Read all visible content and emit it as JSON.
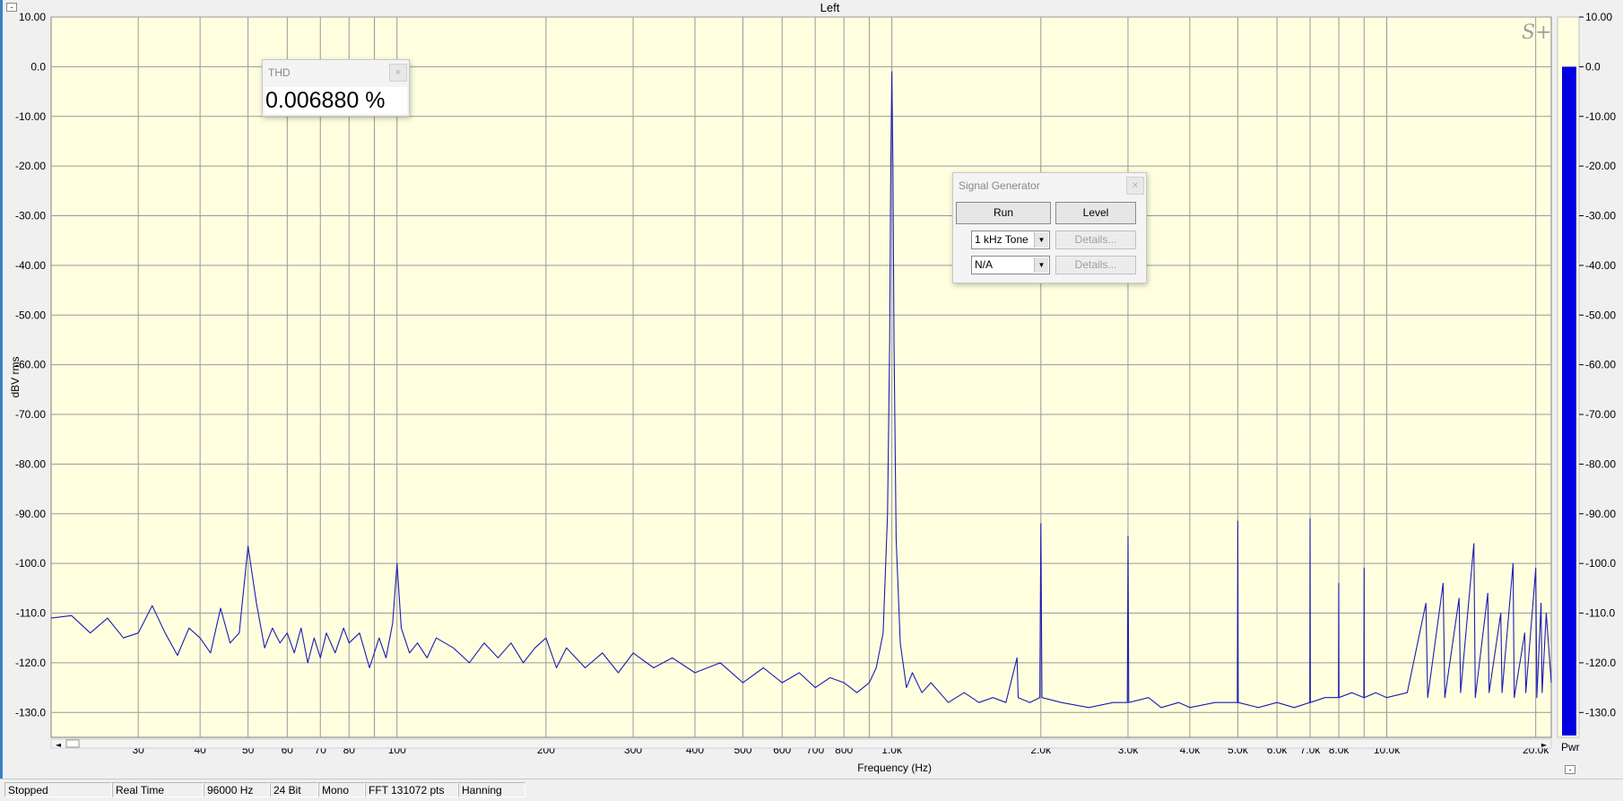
{
  "chart_data": {
    "type": "line",
    "title": "Left",
    "xlabel": "Frequency (Hz)",
    "ylabel": "dBV rms",
    "xscale": "log",
    "xlim": [
      20,
      21500
    ],
    "ylim": [
      -135,
      10
    ],
    "grid": true,
    "x_ticks": [
      {
        "v": 30,
        "label": "30"
      },
      {
        "v": 40,
        "label": "40"
      },
      {
        "v": 50,
        "label": "50"
      },
      {
        "v": 60,
        "label": "60"
      },
      {
        "v": 70,
        "label": "70"
      },
      {
        "v": 80,
        "label": "80"
      },
      {
        "v": 90,
        "label": ""
      },
      {
        "v": 100,
        "label": "100"
      },
      {
        "v": 200,
        "label": "200"
      },
      {
        "v": 300,
        "label": "300"
      },
      {
        "v": 400,
        "label": "400"
      },
      {
        "v": 500,
        "label": "500"
      },
      {
        "v": 600,
        "label": "600"
      },
      {
        "v": 700,
        "label": "700"
      },
      {
        "v": 800,
        "label": "800"
      },
      {
        "v": 900,
        "label": ""
      },
      {
        "v": 1000,
        "label": "1.0k"
      },
      {
        "v": 2000,
        "label": "2.0k"
      },
      {
        "v": 3000,
        "label": "3.0k"
      },
      {
        "v": 4000,
        "label": "4.0k"
      },
      {
        "v": 5000,
        "label": "5.0k"
      },
      {
        "v": 6000,
        "label": "6.0k"
      },
      {
        "v": 7000,
        "label": "7.0k"
      },
      {
        "v": 8000,
        "label": "8.0k"
      },
      {
        "v": 9000,
        "label": ""
      },
      {
        "v": 10000,
        "label": "10.0k"
      },
      {
        "v": 20000,
        "label": "20.0k"
      }
    ],
    "y_ticks": [
      {
        "v": 10,
        "label": "10.00"
      },
      {
        "v": 0,
        "label": "0.0"
      },
      {
        "v": -10,
        "label": "-10.00"
      },
      {
        "v": -20,
        "label": "-20.00"
      },
      {
        "v": -30,
        "label": "-30.00"
      },
      {
        "v": -40,
        "label": "-40.00"
      },
      {
        "v": -50,
        "label": "-50.00"
      },
      {
        "v": -60,
        "label": "-60.00"
      },
      {
        "v": -70,
        "label": "-70.00"
      },
      {
        "v": -80,
        "label": "-80.00"
      },
      {
        "v": -90,
        "label": "-90.00"
      },
      {
        "v": -100,
        "label": "-100.0"
      },
      {
        "v": -110,
        "label": "-110.0"
      },
      {
        "v": -120,
        "label": "-120.0"
      },
      {
        "v": -130,
        "label": "-130.0"
      }
    ],
    "series": [
      {
        "color": "#1c1cb4",
        "points": [
          [
            20,
            -111
          ],
          [
            22,
            -110.5
          ],
          [
            24,
            -114
          ],
          [
            26,
            -111
          ],
          [
            28,
            -115
          ],
          [
            30,
            -114
          ],
          [
            32,
            -108.5
          ],
          [
            34,
            -114
          ],
          [
            36,
            -118.5
          ],
          [
            38,
            -113
          ],
          [
            40,
            -115
          ],
          [
            42,
            -118
          ],
          [
            44,
            -109
          ],
          [
            46,
            -116
          ],
          [
            48,
            -114
          ],
          [
            50,
            -96.5
          ],
          [
            52,
            -108
          ],
          [
            54,
            -117
          ],
          [
            56,
            -113
          ],
          [
            58,
            -116
          ],
          [
            60,
            -114
          ],
          [
            62,
            -118
          ],
          [
            64,
            -113
          ],
          [
            66,
            -120
          ],
          [
            68,
            -115
          ],
          [
            70,
            -119
          ],
          [
            72,
            -114
          ],
          [
            75,
            -118
          ],
          [
            78,
            -113
          ],
          [
            80,
            -116
          ],
          [
            84,
            -114
          ],
          [
            88,
            -121
          ],
          [
            92,
            -115
          ],
          [
            95,
            -119
          ],
          [
            98,
            -112
          ],
          [
            100,
            -100
          ],
          [
            102,
            -113
          ],
          [
            106,
            -118
          ],
          [
            110,
            -116
          ],
          [
            115,
            -119
          ],
          [
            120,
            -115
          ],
          [
            130,
            -117
          ],
          [
            140,
            -120
          ],
          [
            150,
            -116
          ],
          [
            160,
            -119
          ],
          [
            170,
            -116
          ],
          [
            180,
            -120
          ],
          [
            190,
            -117
          ],
          [
            200,
            -115
          ],
          [
            210,
            -121
          ],
          [
            220,
            -117
          ],
          [
            240,
            -121
          ],
          [
            260,
            -118
          ],
          [
            280,
            -122
          ],
          [
            300,
            -118
          ],
          [
            330,
            -121
          ],
          [
            360,
            -119
          ],
          [
            400,
            -122
          ],
          [
            450,
            -120
          ],
          [
            500,
            -124
          ],
          [
            550,
            -121
          ],
          [
            600,
            -124
          ],
          [
            650,
            -122
          ],
          [
            700,
            -125
          ],
          [
            750,
            -123
          ],
          [
            800,
            -124
          ],
          [
            850,
            -126
          ],
          [
            900,
            -124
          ],
          [
            930,
            -121
          ],
          [
            960,
            -114
          ],
          [
            980,
            -90
          ],
          [
            990,
            -55
          ],
          [
            995,
            -20
          ],
          [
            1000,
            -1
          ],
          [
            1005,
            -20
          ],
          [
            1010,
            -55
          ],
          [
            1020,
            -95
          ],
          [
            1040,
            -116
          ],
          [
            1070,
            -125
          ],
          [
            1100,
            -122
          ],
          [
            1150,
            -126
          ],
          [
            1200,
            -124
          ],
          [
            1300,
            -128
          ],
          [
            1400,
            -126
          ],
          [
            1500,
            -128
          ],
          [
            1600,
            -127
          ],
          [
            1700,
            -128
          ],
          [
            1790,
            -119
          ],
          [
            1800,
            -127
          ],
          [
            1900,
            -128
          ],
          [
            1990,
            -127
          ],
          [
            2000,
            -92
          ],
          [
            2010,
            -127
          ],
          [
            2200,
            -128
          ],
          [
            2500,
            -129
          ],
          [
            2800,
            -128
          ],
          [
            2990,
            -128
          ],
          [
            3000,
            -94.5
          ],
          [
            3010,
            -128
          ],
          [
            3300,
            -127
          ],
          [
            3500,
            -129
          ],
          [
            3800,
            -128
          ],
          [
            4000,
            -129
          ],
          [
            4500,
            -128
          ],
          [
            4990,
            -128
          ],
          [
            5000,
            -91.5
          ],
          [
            5010,
            -128
          ],
          [
            5500,
            -129
          ],
          [
            6000,
            -128
          ],
          [
            6500,
            -129
          ],
          [
            6990,
            -128
          ],
          [
            7000,
            -91
          ],
          [
            7010,
            -128
          ],
          [
            7500,
            -127
          ],
          [
            7990,
            -127
          ],
          [
            8000,
            -104
          ],
          [
            8010,
            -127
          ],
          [
            8500,
            -126
          ],
          [
            8990,
            -127
          ],
          [
            9000,
            -101
          ],
          [
            9010,
            -127
          ],
          [
            9500,
            -126
          ],
          [
            10000,
            -127
          ],
          [
            11000,
            -126
          ],
          [
            12000,
            -108
          ],
          [
            12100,
            -127
          ],
          [
            13000,
            -104
          ],
          [
            13100,
            -127
          ],
          [
            14000,
            -107
          ],
          [
            14100,
            -126
          ],
          [
            15000,
            -96
          ],
          [
            15100,
            -127
          ],
          [
            16000,
            -106
          ],
          [
            16100,
            -126
          ],
          [
            17000,
            -110
          ],
          [
            17100,
            -126
          ],
          [
            18000,
            -100
          ],
          [
            18100,
            -127
          ],
          [
            19000,
            -114
          ],
          [
            19100,
            -126
          ],
          [
            20000,
            -101
          ],
          [
            20100,
            -127
          ],
          [
            20500,
            -108
          ],
          [
            20600,
            -126
          ],
          [
            21000,
            -110
          ],
          [
            21500,
            -124
          ]
        ]
      }
    ],
    "meter": {
      "label": "Pwr",
      "level_dbv": 0,
      "scale_ticks": [
        {
          "v": 10,
          "label": "10.00"
        },
        {
          "v": 0,
          "label": "0.0"
        },
        {
          "v": -10,
          "label": "-10.00"
        },
        {
          "v": -20,
          "label": "-20.00"
        },
        {
          "v": -30,
          "label": "-30.00"
        },
        {
          "v": -40,
          "label": "-40.00"
        },
        {
          "v": -50,
          "label": "-50.00"
        },
        {
          "v": -60,
          "label": "-60.00"
        },
        {
          "v": -70,
          "label": "-70.00"
        },
        {
          "v": -80,
          "label": "-80.00"
        },
        {
          "v": -90,
          "label": "-90.00"
        },
        {
          "v": -100,
          "label": "-100.0"
        },
        {
          "v": -110,
          "label": "-110.0"
        },
        {
          "v": -120,
          "label": "-120.0"
        },
        {
          "v": -130,
          "label": "-130.0"
        }
      ],
      "color": "#0000e0"
    },
    "colors": {
      "plot_bg": "#ffffe0",
      "grid": "#999999",
      "trace": "#1c1cb4"
    }
  },
  "logo": "S+",
  "thd_panel": {
    "title": "THD",
    "value": "0.006880 %"
  },
  "signal_generator": {
    "title": "Signal Generator",
    "run_label": "Run",
    "level_label": "Level",
    "source1": "1 kHz Tone",
    "source2": "N/A",
    "details1": "Details...",
    "details2": "Details..."
  },
  "status": {
    "state": "Stopped",
    "mode": "Real Time",
    "sample_rate": "96000 Hz",
    "bits": "24 Bit",
    "channels": "Mono",
    "fft": "FFT 131072 pts",
    "window": "Hanning"
  }
}
